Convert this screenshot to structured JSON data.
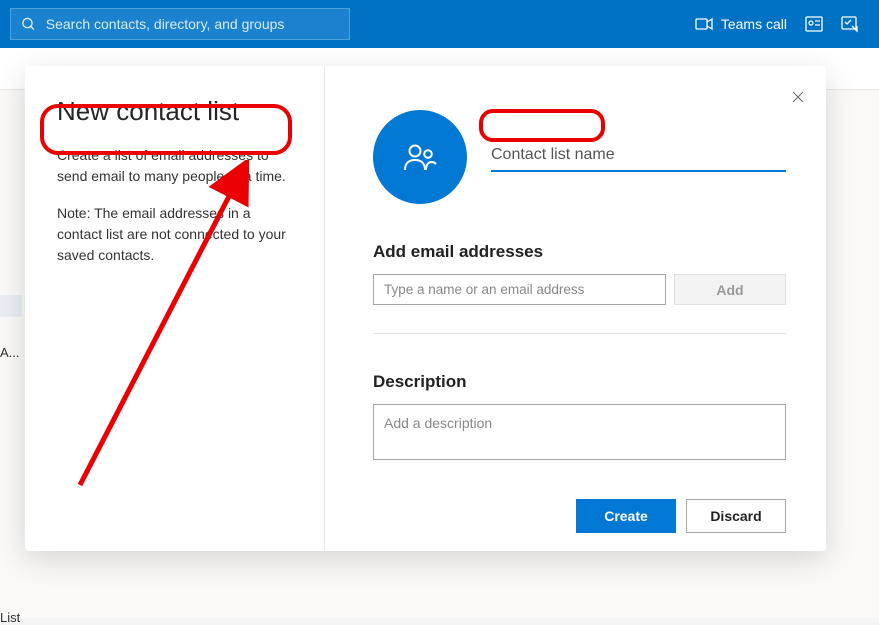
{
  "topbar": {
    "search_placeholder": "Search contacts, directory, and groups",
    "teams_call_label": "Teams call"
  },
  "sidebar": {
    "item_a": "A...",
    "item_list": "List"
  },
  "modal": {
    "title": "New contact list",
    "desc1": "Create a list of email addresses to send email to many people at a time.",
    "desc2": "Note: The email addresses in a contact list are not connected to your saved contacts.",
    "name_placeholder": "Contact list name",
    "emails_label": "Add email addresses",
    "email_placeholder": "Type a name or an email address",
    "add_label": "Add",
    "description_label": "Description",
    "description_placeholder": "Add a description",
    "create_label": "Create",
    "discard_label": "Discard"
  }
}
